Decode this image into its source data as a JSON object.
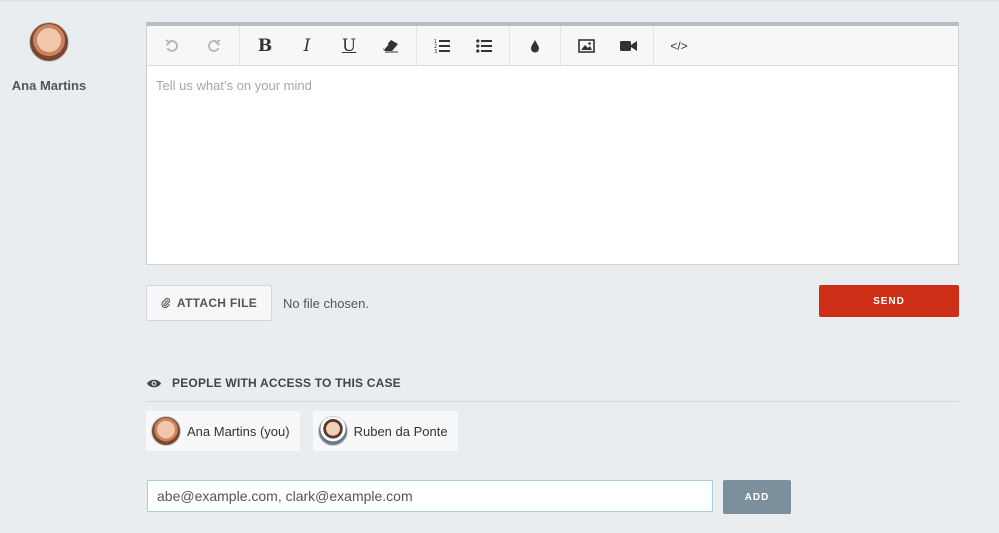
{
  "author": {
    "name": "Ana Martins"
  },
  "editor": {
    "placeholder": "Tell us what’s on your mind",
    "toolbar": {
      "bold": "B",
      "italic": "I",
      "underline": "U",
      "code": "</>"
    }
  },
  "attach": {
    "label": "ATTACH FILE",
    "status": "No file chosen."
  },
  "send_label": "SEND",
  "access": {
    "title": "PEOPLE WITH ACCESS TO THIS CASE",
    "people": [
      {
        "name": "Ana Martins (you)"
      },
      {
        "name": "Ruben da Ponte"
      }
    ],
    "invite_value": "abe@example.com, clark@example.com",
    "add_label": "ADD"
  },
  "colors": {
    "background": "#eaedf0",
    "send": "#cc2f16",
    "add": "#7c8f9d",
    "input_border": "#a9cde0"
  },
  "icons": [
    "undo-icon",
    "redo-icon",
    "eraser-icon",
    "ordered-list-icon",
    "unordered-list-icon",
    "color-drop-icon",
    "image-icon",
    "video-icon",
    "code-icon",
    "paperclip-icon",
    "eye-icon"
  ]
}
